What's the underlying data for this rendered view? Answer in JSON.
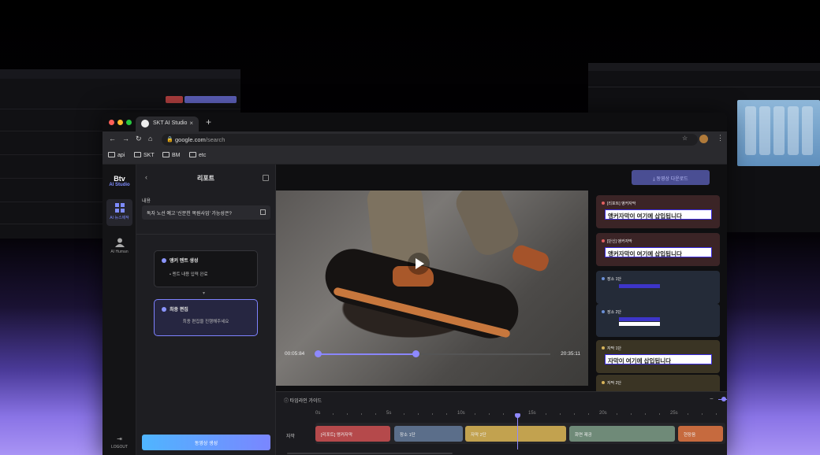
{
  "browser": {
    "tab_title": "SKT AI Studio",
    "tab_close": "×",
    "new_tab": "+",
    "url_host": "google.com",
    "url_path": "/search",
    "bookmarks": [
      "api",
      "SKT",
      "BM",
      "etc"
    ]
  },
  "app": {
    "logo_top": "Btv",
    "logo_bottom": "AI Studio",
    "rail": [
      {
        "label": "AI 뉴스제작",
        "icon": "dashboard-icon",
        "active": true
      },
      {
        "label": "AI Human",
        "icon": "person-icon",
        "active": false
      }
    ],
    "logout": "LOGOUT"
  },
  "panel": {
    "title": "리포트",
    "content_label": "내용",
    "content_value": "독자 노선 예고 '신분천 복원사업' 가능성은?",
    "step1_title": "앵커 멘트 생성",
    "step1_body": "• 멘트 내용 입력 완료",
    "step2_title": "최종 편집",
    "step2_body": "최종 편집을 진행해주세요",
    "generate_button": "동영상 생성"
  },
  "player": {
    "time_current": "00:05:84",
    "time_total": "20:35:11",
    "download_button": "동영상 다운로드",
    "progress": 0.42
  },
  "cards": [
    {
      "tag": "[리포트] 앵커자막",
      "text": "앵커자막이 여기에 삽입됩니다",
      "dot": "#e06060",
      "bg": "#3b2426"
    },
    {
      "tag": "[단신] 앵커자막",
      "text": "앵커자막이 여기에 삽입됩니다",
      "dot": "#e06060",
      "bg": "#3b2426"
    },
    {
      "tag": "장소 1단",
      "text": "",
      "dot": "#6b90d6",
      "bg": "#242b38"
    },
    {
      "tag": "장소 2단",
      "text": "",
      "dot": "#6b90d6",
      "bg": "#242b38"
    },
    {
      "tag": "자막 1단",
      "text": "자막이 여기에 삽입됩니다",
      "dot": "#d8b45a",
      "bg": "#3a3424"
    },
    {
      "tag": "자막 2단",
      "text": "",
      "dot": "#d8b45a",
      "bg": "#3a3424"
    }
  ],
  "timeline": {
    "title": "타임라인 가이드",
    "zoom_minus": "−",
    "ticks": [
      "0s",
      "5s",
      "10s",
      "15s",
      "20s",
      "25s"
    ],
    "track_label": "자막",
    "clips": [
      {
        "label": "[리포트] 앵커자막",
        "color": "#b5494b"
      },
      {
        "label": "장소 1단",
        "color": "#5b6e8a"
      },
      {
        "label": "자막 2단",
        "color": "#c2a24f"
      },
      {
        "label": "화면 제공",
        "color": "#6f8a78"
      },
      {
        "label": "현장음",
        "color": "#c66a3e"
      }
    ]
  }
}
